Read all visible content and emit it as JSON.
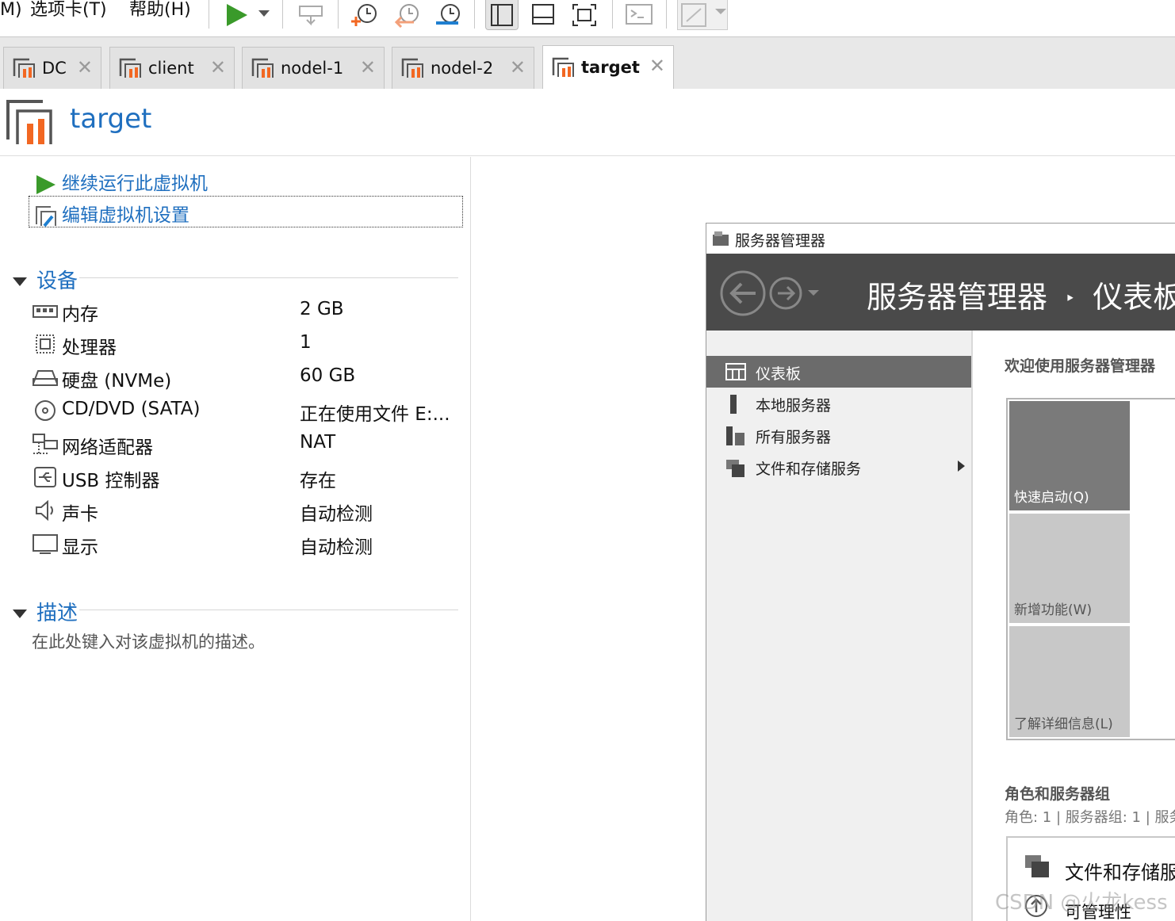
{
  "menu": {
    "item_partial": "M)",
    "tabs_menu": "选项卡(T)",
    "help_menu": "帮助(H)"
  },
  "colors": {
    "accent": "#1f6fbf",
    "play": "#3a9a2a",
    "vm_orange": "#f26722"
  },
  "tabs": [
    {
      "label": "DC"
    },
    {
      "label": "client"
    },
    {
      "label": "nodel-1"
    },
    {
      "label": "nodel-2"
    },
    {
      "label": "target"
    }
  ],
  "vm": {
    "title": "target"
  },
  "actions": {
    "resume": "继续运行此虚拟机",
    "edit": "编辑虚拟机设置"
  },
  "devices_section": {
    "title": "设备"
  },
  "devices": [
    {
      "name": "内存",
      "value": "2 GB",
      "icon": "memory-icon"
    },
    {
      "name": "处理器",
      "value": "1",
      "icon": "cpu-icon"
    },
    {
      "name": "硬盘 (NVMe)",
      "value": "60 GB",
      "icon": "harddisk-icon"
    },
    {
      "name": "CD/DVD (SATA)",
      "value": "正在使用文件 E:...",
      "icon": "cdrom-icon"
    },
    {
      "name": "网络适配器",
      "value": "NAT",
      "icon": "network-icon"
    },
    {
      "name": "USB 控制器",
      "value": "存在",
      "icon": "usb-icon"
    },
    {
      "name": "声卡",
      "value": "自动检测",
      "icon": "speaker-icon"
    },
    {
      "name": "显示",
      "value": "自动检测",
      "icon": "monitor-icon"
    }
  ],
  "description_section": {
    "title": "描述",
    "placeholder": "在此处键入对该虚拟机的描述。"
  },
  "console": {
    "window_title": "服务器管理器",
    "header_title": "服务器管理器",
    "header_separator": "‣",
    "header_page": "仪表板",
    "nav": [
      {
        "label": "仪表板"
      },
      {
        "label": "本地服务器"
      },
      {
        "label": "所有服务器"
      },
      {
        "label": "文件和存储服务"
      }
    ],
    "welcome": "欢迎使用服务器管理器",
    "quick_tiles": [
      {
        "label": "快速启动(Q)"
      },
      {
        "label": "新增功能(W)"
      },
      {
        "label": "了解详细信息(L)"
      }
    ],
    "roles_title": "角色和服务器组",
    "roles_sub": "角色: 1 | 服务器组: 1 | 服务",
    "role_card_title": "文件和存储服",
    "role_card_sub": "可管理性"
  },
  "watermark": "CSDN @火龙kess"
}
